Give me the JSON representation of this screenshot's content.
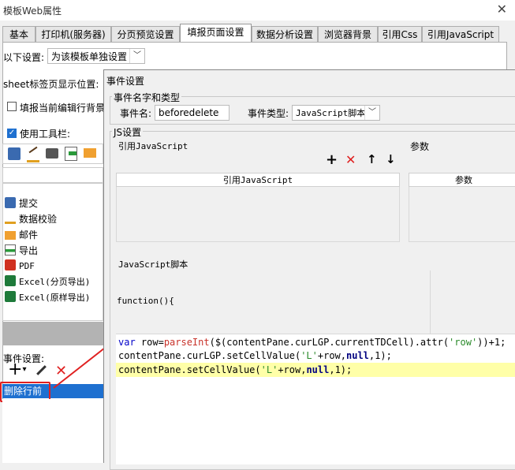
{
  "window": {
    "title": "模板Web属性",
    "close_glyph": "✕"
  },
  "tabs": [
    {
      "label": "基本"
    },
    {
      "label": "打印机(服务器)"
    },
    {
      "label": "分页预览设置"
    },
    {
      "label": "填报页面设置"
    },
    {
      "label": "数据分析设置"
    },
    {
      "label": "浏览器背景"
    },
    {
      "label": "引用Css"
    },
    {
      "label": "引用JavaScript"
    }
  ],
  "active_tab": "填报页面设置",
  "settings": {
    "scope_label": "以下设置:",
    "scope_value": "为该模板单独设置",
    "sheet_pos_label": "sheet标签页显示位置:",
    "fill_bg_label": "填报当前编辑行背景",
    "fill_bg_checked": false,
    "toolbar_label": "使用工具栏:",
    "toolbar_checked": true
  },
  "toolbar_items": [
    {
      "label": "提交",
      "icon": "submit-icon"
    },
    {
      "label": "数据校验",
      "icon": "validate-icon"
    },
    {
      "label": "邮件",
      "icon": "mail-icon"
    },
    {
      "label": "导出",
      "icon": "export-icon"
    },
    {
      "label": "PDF",
      "icon": "pdf-icon"
    },
    {
      "label": "Excel(分页导出)",
      "icon": "excel-icon"
    },
    {
      "label": "Excel(原样导出)",
      "icon": "excel-icon"
    }
  ],
  "event_settings": {
    "label": "事件设置:",
    "add_glyph": "+",
    "add_arrow": "▾",
    "delete_glyph": "✕",
    "selected_event": "删除行前"
  },
  "dialog": {
    "title": "事件设置",
    "name_group": "事件名字和类型",
    "event_name_label": "事件名:",
    "event_name_value": "beforedelete",
    "event_type_label": "事件类型:",
    "event_type_value": "JavaScript脚本",
    "js_group": "JS设置",
    "ref_js_label": "引用JavaScript",
    "params_label": "参数",
    "ref_js_header": "引用JavaScript",
    "params_header": "参数",
    "script_label": "JavaScript脚本",
    "function_line": "function(){",
    "buttons": {
      "add": "+",
      "delete": "✕",
      "up": "↑",
      "down": "↓"
    }
  },
  "code": {
    "line1": {
      "kw": "var",
      "a": " row=",
      "fn": "parseInt",
      "b": "($(contentPane.curLGP.currentTDCell).attr(",
      "str": "'row'",
      "c": "))+1;"
    },
    "line2": {
      "a": "contentPane.curLGP.setCellValue(",
      "str": "'L'",
      "b": "+row,",
      "kw": "null",
      "c": ",1);"
    },
    "line3": {
      "a": "contentPane.setCellValue(",
      "str": "'L'",
      "b": "+row,",
      "kw": "null",
      "c": ",1);"
    }
  },
  "colors": {
    "selection": "#1e70d0",
    "highlight_line": "#ffffa8",
    "annotation_red": "#e02020",
    "keyword": "#0000c8",
    "string": "#2a8a2a"
  }
}
